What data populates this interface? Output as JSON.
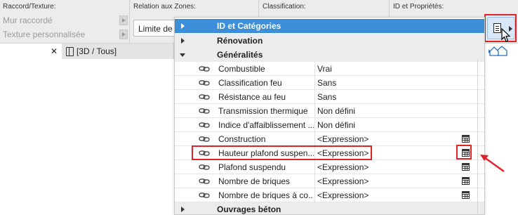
{
  "toolbar": {
    "raccord_header": "Raccord/Texture:",
    "relation_header": "Relation aux Zones:",
    "classification_header": "Classification:",
    "id_header": "ID et Propriétés:",
    "raccord_items": [
      "Mur raccordé",
      "Texture personnalisée"
    ],
    "zone_value": "Limite de"
  },
  "view_tab": {
    "close": "✕",
    "label": "[3D / Tous]"
  },
  "panel": {
    "categories": {
      "id_categories": "ID et Catégories",
      "renovation": "Rénovation",
      "generalites": "Généralités",
      "ouvrages_beton": "Ouvrages béton"
    },
    "properties": [
      {
        "name": "Combustible",
        "value": "Vrai",
        "calc": false
      },
      {
        "name": "Classification feu",
        "value": "Sans",
        "calc": false
      },
      {
        "name": "Résistance au feu",
        "value": "Sans",
        "calc": false
      },
      {
        "name": "Transmission thermique",
        "value": "Non défini",
        "calc": false
      },
      {
        "name": "Indice d'affaiblissement ...",
        "value": "Non défini",
        "calc": false
      },
      {
        "name": "Construction",
        "value": "<Expression>",
        "calc": true
      },
      {
        "name": "Hauteur plafond suspen...",
        "value": "<Expression>",
        "calc": true
      },
      {
        "name": "Plafond suspendu",
        "value": "<Expression>",
        "calc": true
      },
      {
        "name": "Nombre de briques",
        "value": "<Expression>",
        "calc": true
      },
      {
        "name": "Nombre de briques à co...",
        "value": "<Expression>",
        "calc": true
      }
    ]
  },
  "colors": {
    "highlight": "#e0232a",
    "selected_row": "#3d8ed8",
    "panel_bg": "#ffffff",
    "toolbar_bg": "#ececec"
  },
  "icons": [
    "link-icon",
    "calculator-icon",
    "document-list-icon",
    "cube-view-icon",
    "house-view-icon",
    "mouse-cursor-icon",
    "red-arrow-icon"
  ]
}
